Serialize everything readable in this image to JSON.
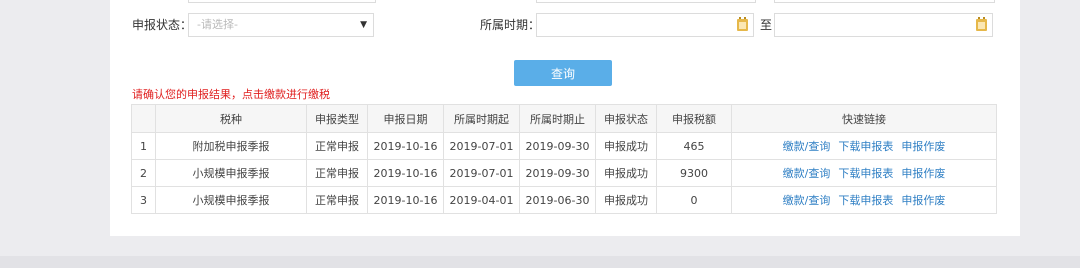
{
  "form": {
    "status_label": "申报状态：",
    "status_placeholder": "-请选择-",
    "period_label": "所属时期：",
    "to_label": "至"
  },
  "query_button": "查询",
  "notice": "请确认您的申报结果，点击缴款进行缴税",
  "table": {
    "headers": [
      "",
      "税种",
      "申报类型",
      "申报日期",
      "所属时期起",
      "所属时期止",
      "申报状态",
      "申报税额",
      "快速链接"
    ],
    "rows": [
      {
        "index": "1",
        "tax_type": "附加税申报季报",
        "declare_type": "正常申报",
        "declare_date": "2019-10-16",
        "period_start": "2019-07-01",
        "period_end": "2019-09-30",
        "status": "申报成功",
        "amount": "465"
      },
      {
        "index": "2",
        "tax_type": "小规模申报季报",
        "declare_type": "正常申报",
        "declare_date": "2019-10-16",
        "period_start": "2019-07-01",
        "period_end": "2019-09-30",
        "status": "申报成功",
        "amount": "9300"
      },
      {
        "index": "3",
        "tax_type": "小规模申报季报",
        "declare_type": "正常申报",
        "declare_date": "2019-10-16",
        "period_start": "2019-04-01",
        "period_end": "2019-06-30",
        "status": "申报成功",
        "amount": "0"
      }
    ],
    "links": {
      "pay": "缴款/查询",
      "download": "下载申报表",
      "void": "申报作废"
    }
  },
  "colors": {
    "primary": "#5aaee8",
    "notice": "#e02020",
    "link": "#2f7fc4",
    "calendar": "#e6b84a"
  },
  "icons": {
    "calendar": "calendar-icon",
    "dropdown": "chevron-down-icon"
  }
}
